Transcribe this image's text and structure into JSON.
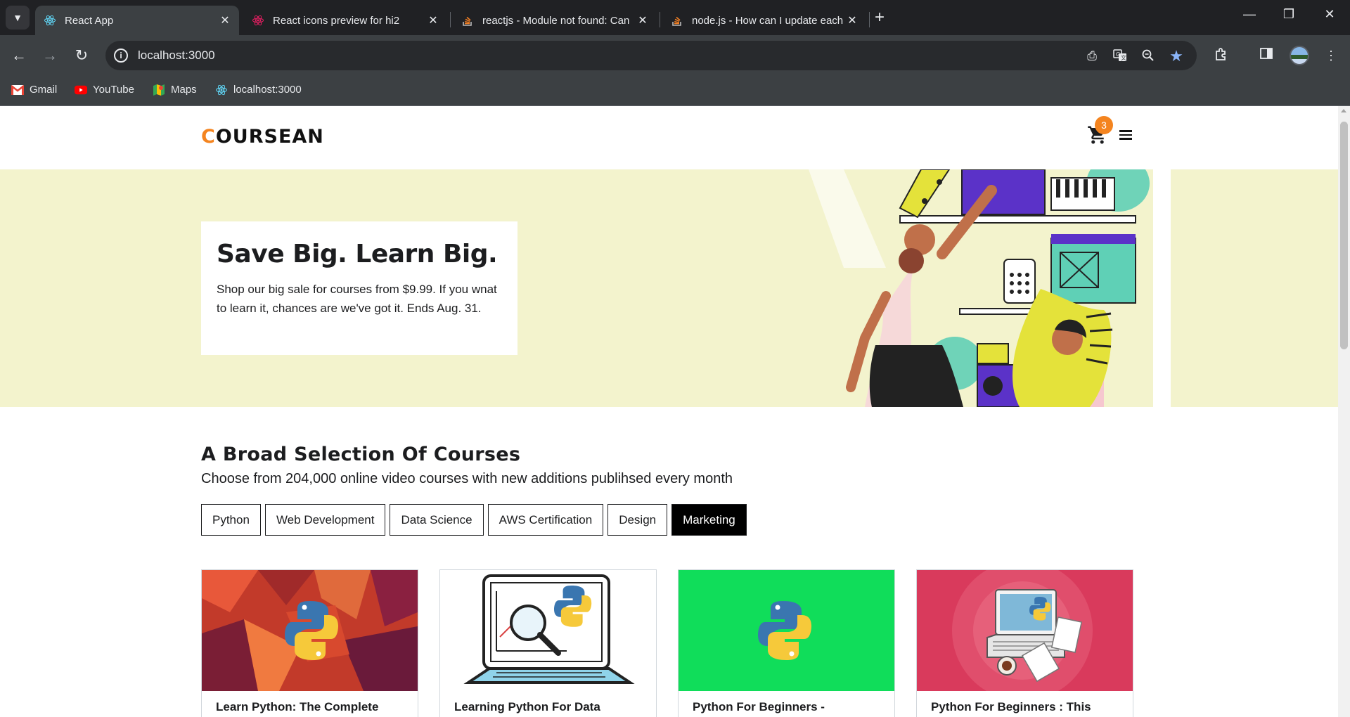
{
  "browser": {
    "tabs": [
      {
        "title": "React App",
        "active": true,
        "icon": "react-icon"
      },
      {
        "title": "React icons preview for hi2",
        "active": false,
        "icon": "react-icon"
      },
      {
        "title": "reactjs - Module not found: Can",
        "active": false,
        "icon": "stackoverflow-icon"
      },
      {
        "title": "node.js - How can I update each",
        "active": false,
        "icon": "stackoverflow-icon"
      }
    ],
    "url": "localhost:3000",
    "bookmarks": [
      {
        "label": "Gmail",
        "icon": "gmail-icon"
      },
      {
        "label": "YouTube",
        "icon": "youtube-icon"
      },
      {
        "label": "Maps",
        "icon": "maps-icon"
      },
      {
        "label": "localhost:3000",
        "icon": "react-icon"
      }
    ]
  },
  "site": {
    "logo_first": "C",
    "logo_rest": "OURSEAN",
    "cart_count": "3",
    "accent": "#f4841f"
  },
  "hero": {
    "title": "Save Big. Learn Big.",
    "text": "Shop our big sale for courses from $9.99. If you wnat to learn it, chances are we've got it. Ends Aug. 31.",
    "background": "#f3f3cd"
  },
  "courses": {
    "heading": "A Broad Selection Of Courses",
    "subheading": "Choose from 204,000 online video courses with new additions publihsed every month",
    "filters": [
      "Python",
      "Web Development",
      "Data Science",
      "AWS Certification",
      "Design",
      "Marketing"
    ],
    "active_filter": "Marketing",
    "cards": [
      {
        "title": "Learn Python: The Complete"
      },
      {
        "title": "Learning Python For Data"
      },
      {
        "title": "Python For Beginners -"
      },
      {
        "title": "Python For Beginners : This"
      }
    ]
  }
}
